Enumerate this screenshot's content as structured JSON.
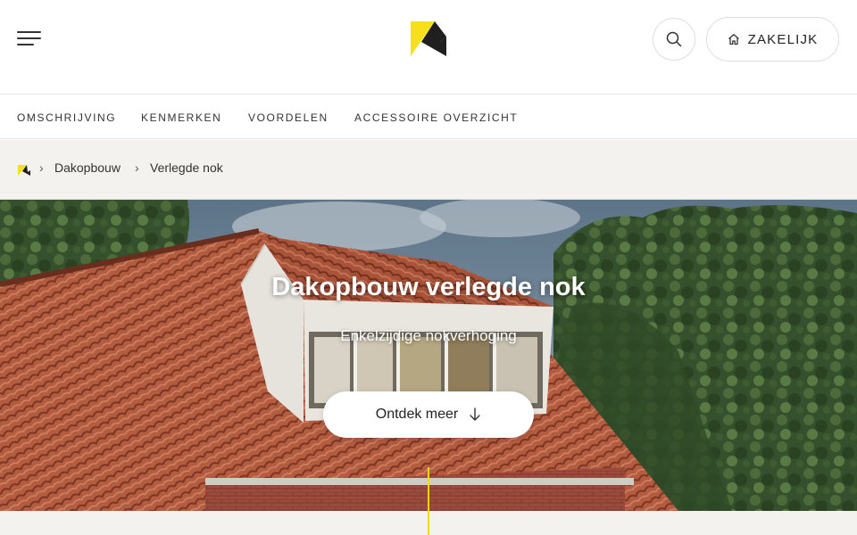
{
  "header": {
    "menu_icon": "hamburger-menu-icon",
    "logo_icon": "brand-logo-icon",
    "search_icon": "search-icon",
    "zakelijk_label": "ZAKELIJK",
    "zakelijk_icon": "home-icon"
  },
  "subnav": {
    "items": [
      {
        "label": "OMSCHRIJVING"
      },
      {
        "label": "KENMERKEN"
      },
      {
        "label": "VOORDELEN"
      },
      {
        "label": "ACCESSOIRE OVERZICHT"
      }
    ]
  },
  "breadcrumb": {
    "home_icon": "brand-logo-icon",
    "separator": "›",
    "items": [
      {
        "label": "Dakopbouw"
      },
      {
        "label": "Verlegde nok"
      }
    ]
  },
  "hero": {
    "title": "Dakopbouw verlegde nok",
    "subtitle": "Enkelzijdige nokverhoging",
    "cta_label": "Ontdek meer",
    "cta_icon": "arrow-down-icon"
  },
  "colors": {
    "brand_yellow": "#f7e01a",
    "brand_dark": "#1f1f1f",
    "tile_red": "#b35a3f",
    "breadcrumb_bg": "#f4f2ef"
  }
}
